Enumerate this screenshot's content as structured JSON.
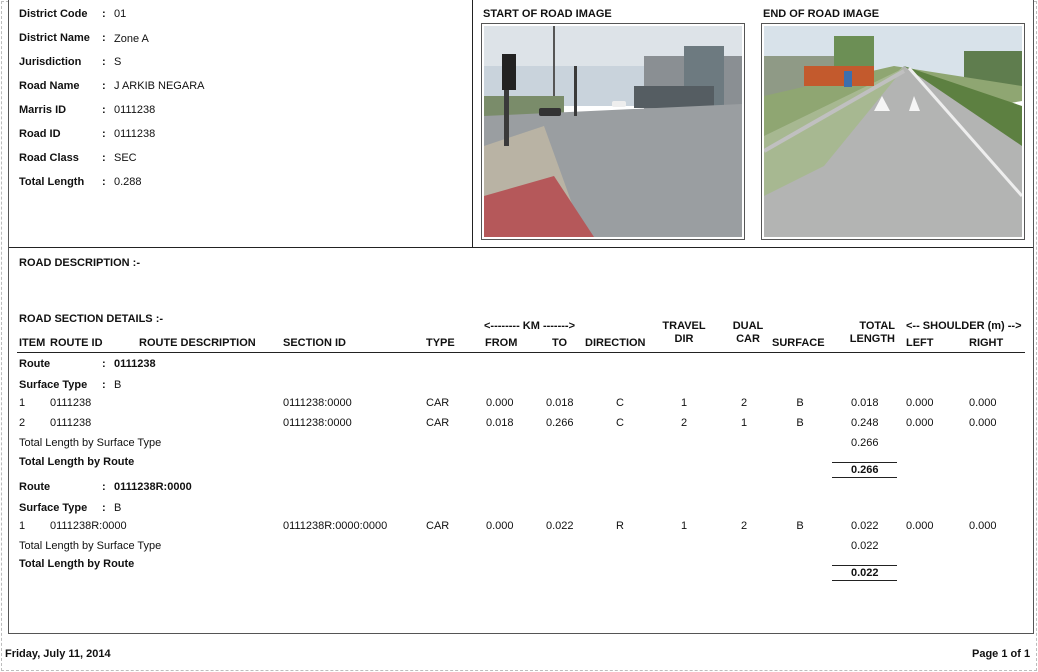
{
  "info": [
    {
      "label": "District Code",
      "value": "01"
    },
    {
      "label": "District Name",
      "value": "Zone A"
    },
    {
      "label": "Jurisdiction",
      "value": "S"
    },
    {
      "label": "Road Name",
      "value": "J ARKIB NEGARA"
    },
    {
      "label": "Marris ID",
      "value": "0111238"
    },
    {
      "label": "Road ID",
      "value": "0111238"
    },
    {
      "label": "Road Class",
      "value": "SEC"
    },
    {
      "label": "Total Length",
      "value": "0.288"
    }
  ],
  "colon": ":",
  "images": {
    "start_title": "START OF ROAD IMAGE",
    "end_title": "END OF ROAD IMAGE"
  },
  "road_description_title": "ROAD DESCRIPTION :-",
  "section_title": "ROAD SECTION DETAILS :-",
  "headers": {
    "km_group": "<-------- KM ------->",
    "shoulder_group": "<-- SHOULDER (m) -->",
    "item": "ITEM",
    "route_id": "ROUTE ID",
    "route_desc": "ROUTE DESCRIPTION",
    "section_id": "SECTION ID",
    "type": "TYPE",
    "from": "FROM",
    "to": "TO",
    "direction": "DIRECTION",
    "travel_1": "TRAVEL",
    "travel_2": "DIR",
    "dual_1": "DUAL",
    "dual_2": "CAR",
    "surface": "SURFACE",
    "total_1": "TOTAL",
    "total_2": "LENGTH",
    "left": "LEFT",
    "right": "RIGHT"
  },
  "labels": {
    "route": "Route",
    "surface_type": "Surface Type",
    "total_by_surface": "Total Length by Surface Type",
    "total_by_route": "Total Length by Route"
  },
  "groups": [
    {
      "route": "0111238",
      "surface_type": "B",
      "rows": [
        {
          "item": "1",
          "route_id": "0111238",
          "section_id": "0111238:0000",
          "type": "CAR",
          "from": "0.000",
          "to": "0.018",
          "direction": "C",
          "travel_dir": "1",
          "dual_car": "2",
          "surface": "B",
          "total_length": "0.018",
          "left": "0.000",
          "right": "0.000"
        },
        {
          "item": "2",
          "route_id": "0111238",
          "section_id": "0111238:0000",
          "type": "CAR",
          "from": "0.018",
          "to": "0.266",
          "direction": "C",
          "travel_dir": "2",
          "dual_car": "1",
          "surface": "B",
          "total_length": "0.248",
          "left": "0.000",
          "right": "0.000"
        }
      ],
      "surface_total": "0.266",
      "route_total": "0.266"
    },
    {
      "route": "0111238R:0000",
      "surface_type": "B",
      "rows": [
        {
          "item": "1",
          "route_id": "0111238R:0000",
          "section_id": "0111238R:0000:0000",
          "type": "CAR",
          "from": "0.000",
          "to": "0.022",
          "direction": "R",
          "travel_dir": "1",
          "dual_car": "2",
          "surface": "B",
          "total_length": "0.022",
          "left": "0.000",
          "right": "0.000"
        }
      ],
      "surface_total": "0.022",
      "route_total": "0.022"
    }
  ],
  "footer": {
    "date": "Friday, July 11, 2014",
    "page": "Page 1 of 1"
  }
}
